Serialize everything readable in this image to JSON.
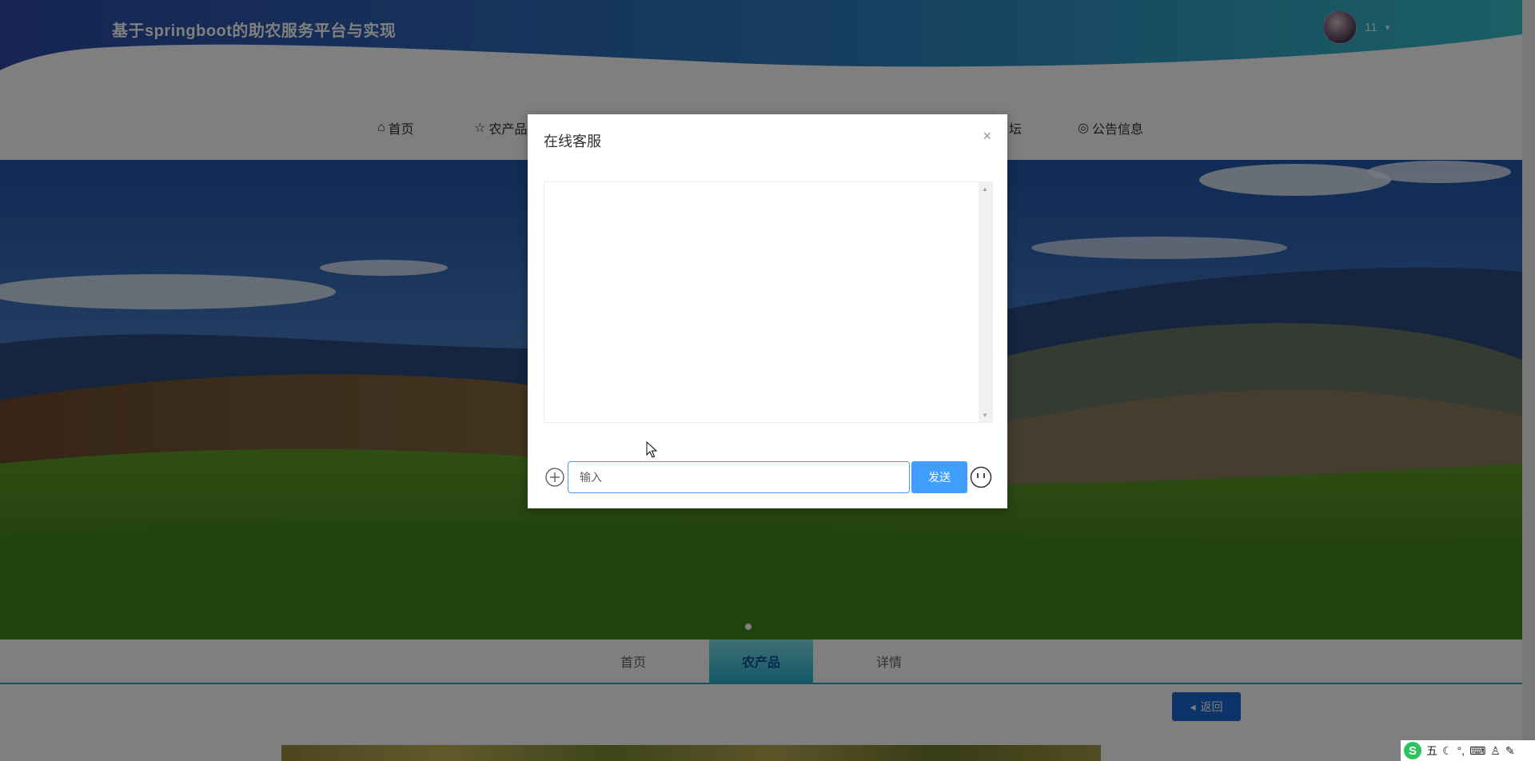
{
  "header": {
    "site_title": "基于springboot的助农服务平台与实现",
    "username": "11",
    "caret": "▾"
  },
  "nav": {
    "items": [
      {
        "icon": "⌂",
        "label": "首页"
      },
      {
        "icon": "☆",
        "label": "农产品"
      },
      {
        "icon": "",
        "label": "坛"
      },
      {
        "icon": "◎",
        "label": "公告信息"
      }
    ]
  },
  "tabs": {
    "items": [
      "首页",
      "农产品",
      "详情"
    ],
    "active_index": 1
  },
  "back_button": {
    "icon": "◂",
    "label": "返回"
  },
  "dialog": {
    "title": "在线客服",
    "close_icon": "×",
    "input_placeholder": "输入",
    "input_value": "",
    "send_label": "发送"
  },
  "ime": {
    "logo": "S",
    "mode": "五",
    "glyphs": [
      "☾",
      "°,",
      "⌨",
      "♙",
      "✎"
    ]
  },
  "colors": {
    "header_gradient_start": "#2a4fa8",
    "header_gradient_end": "#35b9c9",
    "primary_button": "#409eff",
    "back_button": "#1c67d2",
    "tab_active": "#27b1d1"
  }
}
